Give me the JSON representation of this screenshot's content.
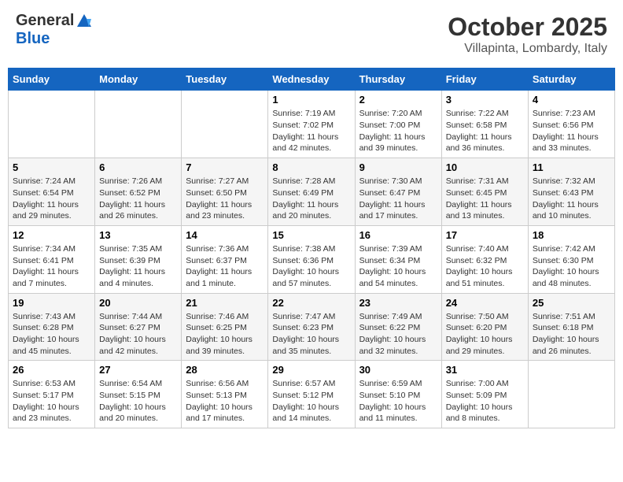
{
  "header": {
    "logo_general": "General",
    "logo_blue": "Blue",
    "month": "October 2025",
    "location": "Villapinta, Lombardy, Italy"
  },
  "weekdays": [
    "Sunday",
    "Monday",
    "Tuesday",
    "Wednesday",
    "Thursday",
    "Friday",
    "Saturday"
  ],
  "weeks": [
    [
      {
        "day": "",
        "info": ""
      },
      {
        "day": "",
        "info": ""
      },
      {
        "day": "",
        "info": ""
      },
      {
        "day": "1",
        "info": "Sunrise: 7:19 AM\nSunset: 7:02 PM\nDaylight: 11 hours and 42 minutes."
      },
      {
        "day": "2",
        "info": "Sunrise: 7:20 AM\nSunset: 7:00 PM\nDaylight: 11 hours and 39 minutes."
      },
      {
        "day": "3",
        "info": "Sunrise: 7:22 AM\nSunset: 6:58 PM\nDaylight: 11 hours and 36 minutes."
      },
      {
        "day": "4",
        "info": "Sunrise: 7:23 AM\nSunset: 6:56 PM\nDaylight: 11 hours and 33 minutes."
      }
    ],
    [
      {
        "day": "5",
        "info": "Sunrise: 7:24 AM\nSunset: 6:54 PM\nDaylight: 11 hours and 29 minutes."
      },
      {
        "day": "6",
        "info": "Sunrise: 7:26 AM\nSunset: 6:52 PM\nDaylight: 11 hours and 26 minutes."
      },
      {
        "day": "7",
        "info": "Sunrise: 7:27 AM\nSunset: 6:50 PM\nDaylight: 11 hours and 23 minutes."
      },
      {
        "day": "8",
        "info": "Sunrise: 7:28 AM\nSunset: 6:49 PM\nDaylight: 11 hours and 20 minutes."
      },
      {
        "day": "9",
        "info": "Sunrise: 7:30 AM\nSunset: 6:47 PM\nDaylight: 11 hours and 17 minutes."
      },
      {
        "day": "10",
        "info": "Sunrise: 7:31 AM\nSunset: 6:45 PM\nDaylight: 11 hours and 13 minutes."
      },
      {
        "day": "11",
        "info": "Sunrise: 7:32 AM\nSunset: 6:43 PM\nDaylight: 11 hours and 10 minutes."
      }
    ],
    [
      {
        "day": "12",
        "info": "Sunrise: 7:34 AM\nSunset: 6:41 PM\nDaylight: 11 hours and 7 minutes."
      },
      {
        "day": "13",
        "info": "Sunrise: 7:35 AM\nSunset: 6:39 PM\nDaylight: 11 hours and 4 minutes."
      },
      {
        "day": "14",
        "info": "Sunrise: 7:36 AM\nSunset: 6:37 PM\nDaylight: 11 hours and 1 minute."
      },
      {
        "day": "15",
        "info": "Sunrise: 7:38 AM\nSunset: 6:36 PM\nDaylight: 10 hours and 57 minutes."
      },
      {
        "day": "16",
        "info": "Sunrise: 7:39 AM\nSunset: 6:34 PM\nDaylight: 10 hours and 54 minutes."
      },
      {
        "day": "17",
        "info": "Sunrise: 7:40 AM\nSunset: 6:32 PM\nDaylight: 10 hours and 51 minutes."
      },
      {
        "day": "18",
        "info": "Sunrise: 7:42 AM\nSunset: 6:30 PM\nDaylight: 10 hours and 48 minutes."
      }
    ],
    [
      {
        "day": "19",
        "info": "Sunrise: 7:43 AM\nSunset: 6:28 PM\nDaylight: 10 hours and 45 minutes."
      },
      {
        "day": "20",
        "info": "Sunrise: 7:44 AM\nSunset: 6:27 PM\nDaylight: 10 hours and 42 minutes."
      },
      {
        "day": "21",
        "info": "Sunrise: 7:46 AM\nSunset: 6:25 PM\nDaylight: 10 hours and 39 minutes."
      },
      {
        "day": "22",
        "info": "Sunrise: 7:47 AM\nSunset: 6:23 PM\nDaylight: 10 hours and 35 minutes."
      },
      {
        "day": "23",
        "info": "Sunrise: 7:49 AM\nSunset: 6:22 PM\nDaylight: 10 hours and 32 minutes."
      },
      {
        "day": "24",
        "info": "Sunrise: 7:50 AM\nSunset: 6:20 PM\nDaylight: 10 hours and 29 minutes."
      },
      {
        "day": "25",
        "info": "Sunrise: 7:51 AM\nSunset: 6:18 PM\nDaylight: 10 hours and 26 minutes."
      }
    ],
    [
      {
        "day": "26",
        "info": "Sunrise: 6:53 AM\nSunset: 5:17 PM\nDaylight: 10 hours and 23 minutes."
      },
      {
        "day": "27",
        "info": "Sunrise: 6:54 AM\nSunset: 5:15 PM\nDaylight: 10 hours and 20 minutes."
      },
      {
        "day": "28",
        "info": "Sunrise: 6:56 AM\nSunset: 5:13 PM\nDaylight: 10 hours and 17 minutes."
      },
      {
        "day": "29",
        "info": "Sunrise: 6:57 AM\nSunset: 5:12 PM\nDaylight: 10 hours and 14 minutes."
      },
      {
        "day": "30",
        "info": "Sunrise: 6:59 AM\nSunset: 5:10 PM\nDaylight: 10 hours and 11 minutes."
      },
      {
        "day": "31",
        "info": "Sunrise: 7:00 AM\nSunset: 5:09 PM\nDaylight: 10 hours and 8 minutes."
      },
      {
        "day": "",
        "info": ""
      }
    ]
  ]
}
